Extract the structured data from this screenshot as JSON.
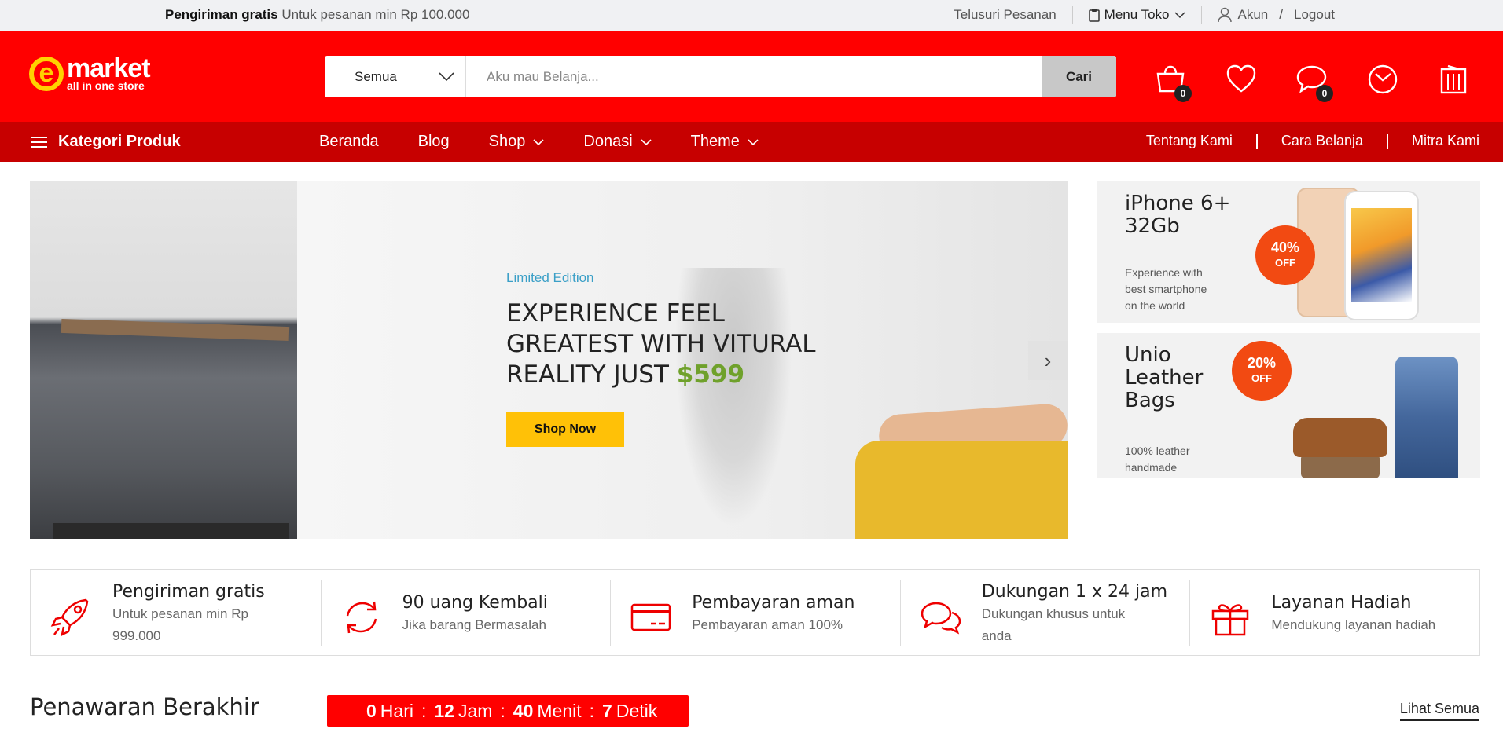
{
  "topbar": {
    "ship_bold": "Pengiriman gratis",
    "ship_text": "Untuk pesanan min Rp 100.000",
    "track": "Telusuri Pesanan",
    "menu_toko": "Menu Toko",
    "akun": "Akun",
    "slash": "/",
    "logout": "Logout"
  },
  "header": {
    "logo_letter": "e",
    "logo_name": "market",
    "logo_tagline": "all in one store",
    "search_category": "Semua",
    "search_placeholder": "Aku mau Belanja...",
    "search_button": "Cari",
    "icons": [
      {
        "name": "cart-icon",
        "badge": "0"
      },
      {
        "name": "heart-icon",
        "badge": ""
      },
      {
        "name": "chat-icon",
        "badge": "0"
      },
      {
        "name": "clock-icon",
        "badge": ""
      },
      {
        "name": "building-icon",
        "badge": ""
      }
    ]
  },
  "nav": {
    "category_label": "Kategori Produk",
    "menu": [
      {
        "label": "Beranda",
        "dropdown": false
      },
      {
        "label": "Blog",
        "dropdown": false
      },
      {
        "label": "Shop",
        "dropdown": true
      },
      {
        "label": "Donasi",
        "dropdown": true
      },
      {
        "label": "Theme",
        "dropdown": true
      }
    ],
    "links": [
      "Tentang Kami",
      "Cara Belanja",
      "Mitra Kami"
    ]
  },
  "hero": {
    "tag": "Limited Edition",
    "headline_1": "EXPERIENCE FEEL",
    "headline_2": "GREATEST WITH VITURAL",
    "headline_3": "REALITY JUST ",
    "price": "$599",
    "cta": "Shop Now",
    "next_arrow": "›"
  },
  "promos": [
    {
      "title_1": "iPhone 6+",
      "title_2": "32Gb",
      "title_3": "",
      "desc": [
        "Experience with",
        "best smartphone",
        "on the world"
      ],
      "discount": "40%",
      "discount_label": "OFF"
    },
    {
      "title_1": "Unio",
      "title_2": "Leather",
      "title_3": "Bags",
      "desc": [
        "100% leather",
        "handmade"
      ],
      "discount": "20%",
      "discount_label": "OFF"
    }
  ],
  "features": [
    {
      "icon": "rocket-icon",
      "title": "Pengiriman gratis",
      "sub_1": "Untuk pesanan min Rp",
      "sub_2": "999.000"
    },
    {
      "icon": "refresh-icon",
      "title": "90 uang Kembali",
      "sub_1": "Jika barang Bermasalah",
      "sub_2": ""
    },
    {
      "icon": "credit-card-icon",
      "title": "Pembayaran aman",
      "sub_1": "Pembayaran aman 100%",
      "sub_2": ""
    },
    {
      "icon": "chat-support-icon",
      "title": "Dukungan 1 x 24 jam",
      "sub_1": "Dukungan khusus untuk",
      "sub_2": "anda"
    },
    {
      "icon": "gift-icon",
      "title": "Layanan Hadiah",
      "sub_1": "Mendukung layanan hadiah",
      "sub_2": ""
    }
  ],
  "offer": {
    "title": "Penawaran Berakhir",
    "days": "0",
    "days_label": "Hari",
    "hours": "12",
    "hours_label": "Jam",
    "minutes": "40",
    "minutes_label": "Menit",
    "seconds": "7",
    "seconds_label": "Detik",
    "colon": ":",
    "see_all": "Lihat Semua"
  },
  "colors": {
    "brand_red": "#ff0000",
    "nav_red": "#c70000",
    "logo_yellow": "#ffd200",
    "cta_yellow": "#ffc107",
    "price_green": "#6fa12b",
    "tag_blue": "#3a9fc7",
    "discount_orange": "#f24a12"
  }
}
